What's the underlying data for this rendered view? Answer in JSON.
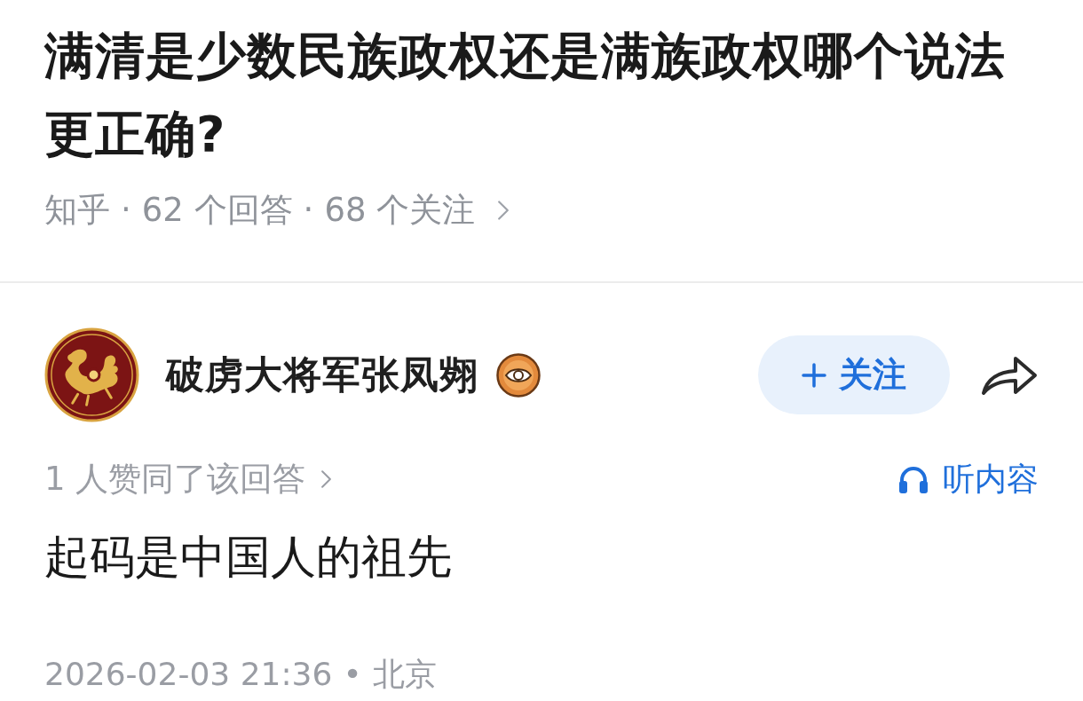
{
  "question": {
    "title": "满清是少数民族政权还是满族政权哪个说法更正确?",
    "meta": [
      "知乎",
      "·",
      "62 个回答",
      "·",
      "68 个关注"
    ]
  },
  "answer": {
    "author": {
      "name": "破虏大将军张凤翙"
    },
    "follow_button": {
      "label": "关注",
      "following": false
    },
    "upvote_summary": "1 人赞同了该回答",
    "listen_button": "听内容",
    "content": "起码是中国人的祖先",
    "footer": [
      "2026-02-03 21:36",
      "•",
      "北京"
    ]
  }
}
